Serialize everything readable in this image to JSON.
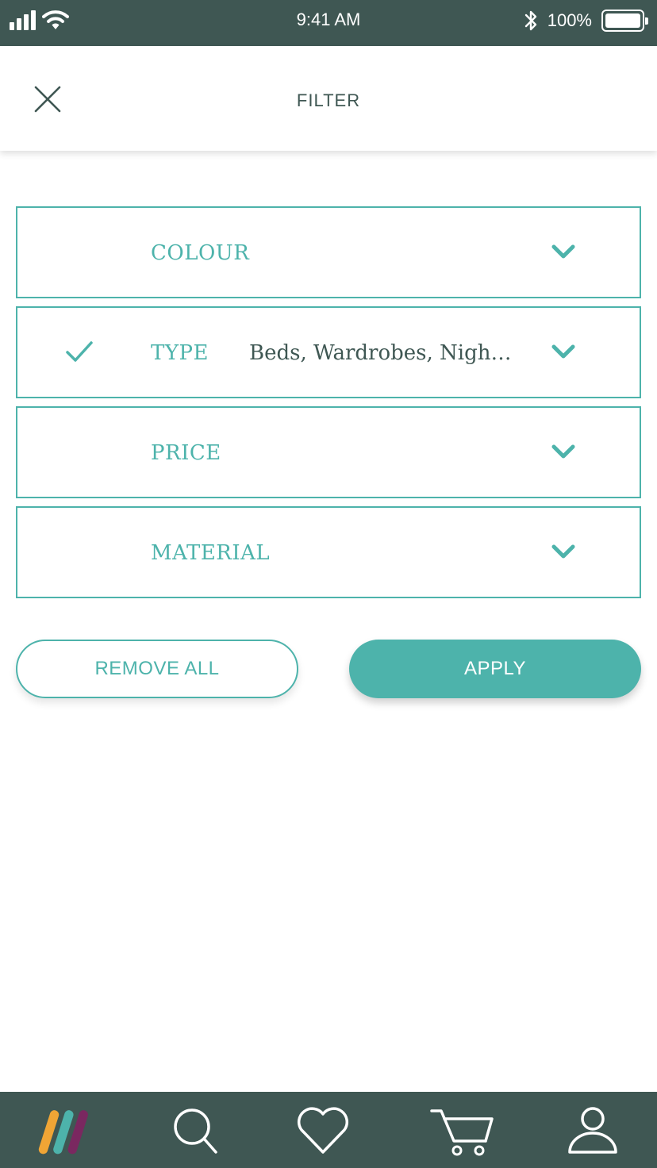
{
  "status_bar": {
    "time": "9:41 AM",
    "battery_percent": "100%",
    "icons": [
      "signal-icon",
      "wifi-icon",
      "bluetooth-icon",
      "battery-icon"
    ]
  },
  "header": {
    "title": "FILTER",
    "close_icon": "close-icon"
  },
  "filters": [
    {
      "label": "COLOUR",
      "value": "",
      "selected": false
    },
    {
      "label": "TYPE",
      "value": "Beds, Wardrobes, Night…",
      "selected": true
    },
    {
      "label": "PRICE",
      "value": "",
      "selected": false
    },
    {
      "label": "MATERIAL",
      "value": "",
      "selected": false
    }
  ],
  "actions": {
    "remove_all": "REMOVE ALL",
    "apply": "APPLY"
  },
  "bottom_nav": {
    "items": [
      "home-logo-icon",
      "search-icon",
      "heart-icon",
      "cart-icon",
      "profile-icon"
    ]
  },
  "colors": {
    "accent": "#4db3ab",
    "dark": "#3f5753",
    "logo_orange": "#f0a535",
    "logo_teal": "#4db3ab",
    "logo_purple": "#7a2860"
  }
}
